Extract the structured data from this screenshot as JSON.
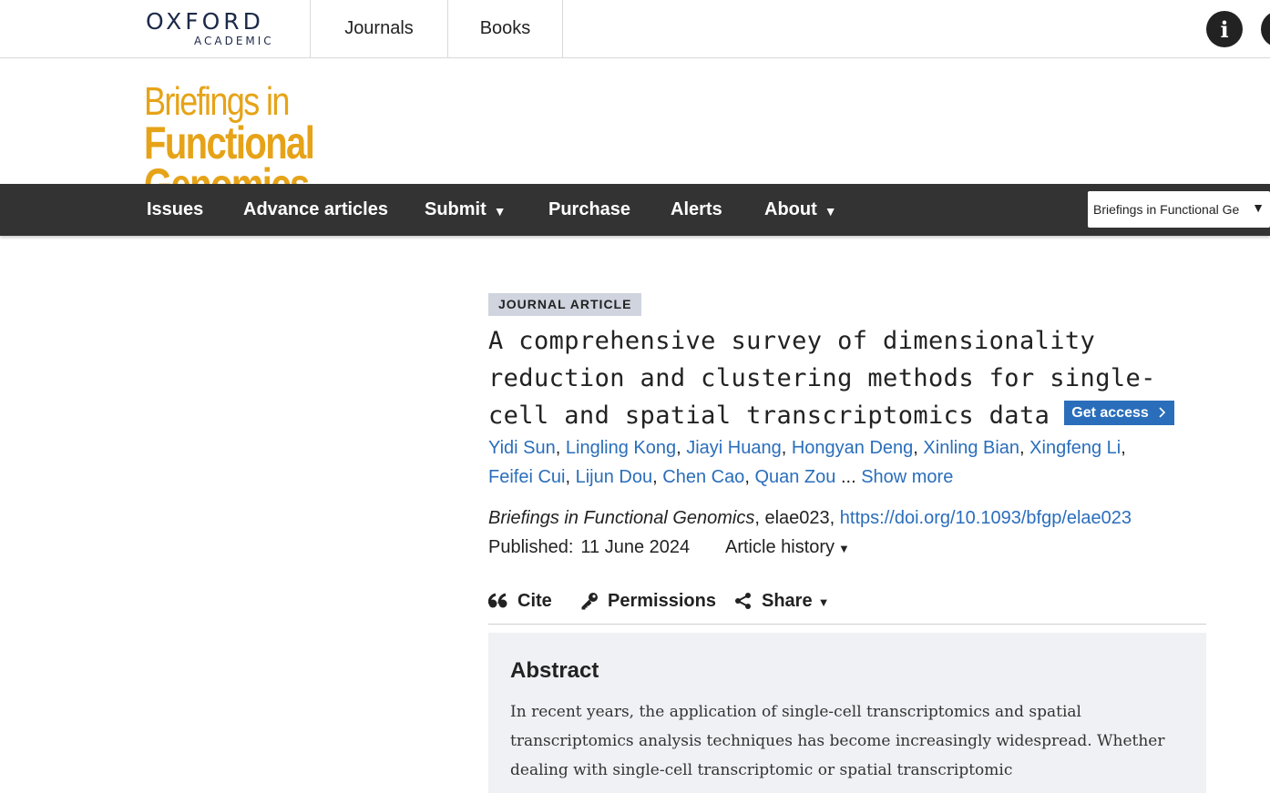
{
  "header": {
    "logo_main": "OXFORD",
    "logo_sub": "ACADEMIC",
    "nav": [
      "Journals",
      "Books"
    ],
    "info_icon": "info-icon",
    "user_icon": "user-icon"
  },
  "journal": {
    "title_line1": "Briefings in",
    "title_line2": "Functional Genomics",
    "brand_color": "#e6a318"
  },
  "mainnav": {
    "items": [
      {
        "label": "Issues",
        "dropdown": false
      },
      {
        "label": "Advance articles",
        "dropdown": false
      },
      {
        "label": "Submit",
        "dropdown": true
      },
      {
        "label": "Purchase",
        "dropdown": false
      },
      {
        "label": "Alerts",
        "dropdown": false
      },
      {
        "label": "About",
        "dropdown": true
      }
    ],
    "caret": "▼",
    "journal_select": "Briefings in Functional Ge",
    "background": "#333333"
  },
  "article": {
    "type_badge": "JOURNAL ARTICLE",
    "title": "A comprehensive survey of dimensionality reduction and clustering methods for single-cell and spatial transcriptomics data",
    "get_access": "Get access",
    "authors": [
      "Yidi Sun",
      "Lingling Kong",
      "Jiayi Huang",
      "Hongyan Deng",
      "Xinling Bian",
      "Xingfeng Li",
      "Feifei Cui",
      "Lijun Dou",
      "Chen Cao",
      "Quan Zou"
    ],
    "authors_ellipsis": "...",
    "show_more": "Show more",
    "journal_name": "Briefings in Functional Genomics",
    "article_id": "elae023",
    "doi": "https://doi.org/10.1093/bfgp/elae023",
    "published_label": "Published:",
    "published_date": "11 June 2024",
    "article_history": "Article history",
    "link_color": "#2a6ebb"
  },
  "actions": {
    "cite": "Cite",
    "permissions": "Permissions",
    "share": "Share"
  },
  "abstract": {
    "heading": "Abstract",
    "text": "In recent years, the application of single-cell transcriptomics and spatial transcriptomics analysis techniques has become increasingly widespread. Whether dealing with single-cell transcriptomic or spatial transcriptomic"
  }
}
